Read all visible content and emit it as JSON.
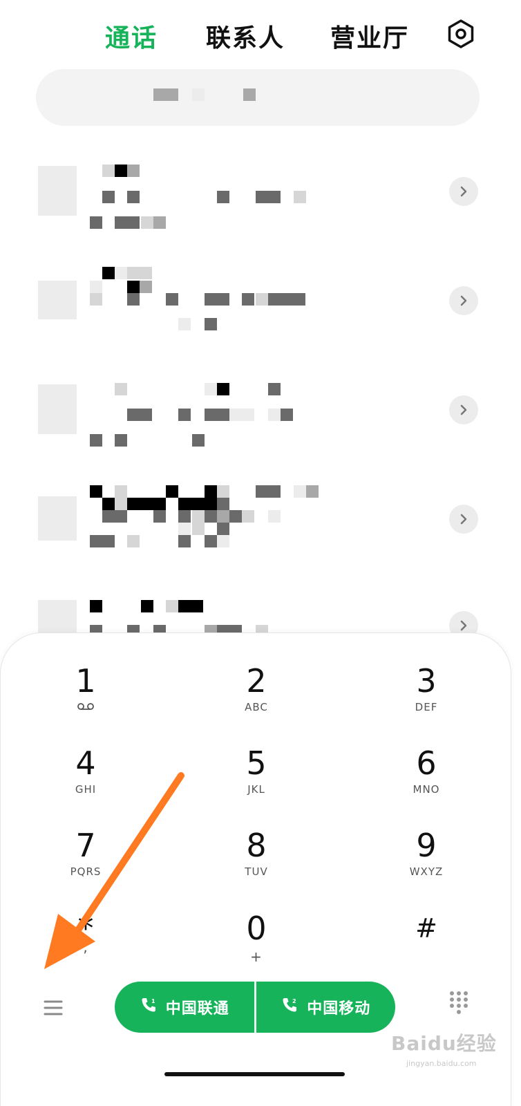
{
  "tabs": [
    {
      "label": "通话",
      "active": true
    },
    {
      "label": "联系人",
      "active": false
    },
    {
      "label": "营业厅",
      "active": false
    }
  ],
  "accent_color": "#16b35b",
  "dialpad": {
    "keys": [
      {
        "digit": "1",
        "letters": ""
      },
      {
        "digit": "2",
        "letters": "ABC"
      },
      {
        "digit": "3",
        "letters": "DEF"
      },
      {
        "digit": "4",
        "letters": "GHI"
      },
      {
        "digit": "5",
        "letters": "JKL"
      },
      {
        "digit": "6",
        "letters": "MNO"
      },
      {
        "digit": "7",
        "letters": "PQRS"
      },
      {
        "digit": "8",
        "letters": "TUV"
      },
      {
        "digit": "9",
        "letters": "WXYZ"
      },
      {
        "digit": "*",
        "letters": ","
      },
      {
        "digit": "0",
        "letters": "+"
      },
      {
        "digit": "#",
        "letters": ""
      }
    ]
  },
  "call_buttons": [
    {
      "label": "中国联通",
      "sim": "1"
    },
    {
      "label": "中国移动",
      "sim": "2"
    }
  ],
  "icons": {
    "settings": "settings-icon",
    "chevron": "chevron-right-icon",
    "menu": "menu-icon",
    "dialpad_toggle": "dialpad-grid-icon",
    "voicemail": "voicemail-icon"
  },
  "watermark": {
    "main": "Baidu经验",
    "sub": "jingyan.baidu.com"
  }
}
